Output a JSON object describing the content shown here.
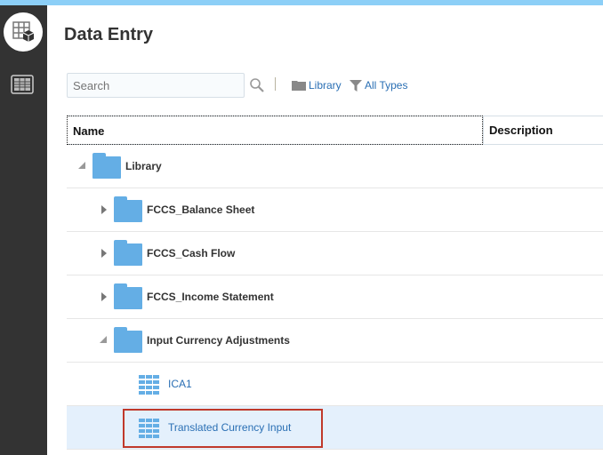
{
  "header": {
    "title": "Data Entry"
  },
  "toolbar": {
    "search_placeholder": "Search",
    "library_label": "Library",
    "types_label": "All Types"
  },
  "table": {
    "columns": [
      "Name",
      "Description"
    ],
    "rows": [
      {
        "label": "Library",
        "type": "folder",
        "level": 0,
        "state": "expanded"
      },
      {
        "label": "FCCS_Balance Sheet",
        "type": "folder",
        "level": 1,
        "state": "collapsed"
      },
      {
        "label": "FCCS_Cash Flow",
        "type": "folder",
        "level": 1,
        "state": "collapsed"
      },
      {
        "label": "FCCS_Income Statement",
        "type": "folder",
        "level": 1,
        "state": "collapsed"
      },
      {
        "label": "Input Currency Adjustments",
        "type": "folder",
        "level": 1,
        "state": "expanded"
      },
      {
        "label": "ICA1",
        "type": "form",
        "level": 2
      },
      {
        "label": "Translated Currency Input",
        "type": "form",
        "level": 2,
        "selected": true
      }
    ]
  },
  "colors": {
    "accent": "#2a6fb4",
    "folder": "#64aee5",
    "selected_bg": "#e4f0fc",
    "highlight": "#c0392b",
    "topbar": "#8ccff7"
  }
}
